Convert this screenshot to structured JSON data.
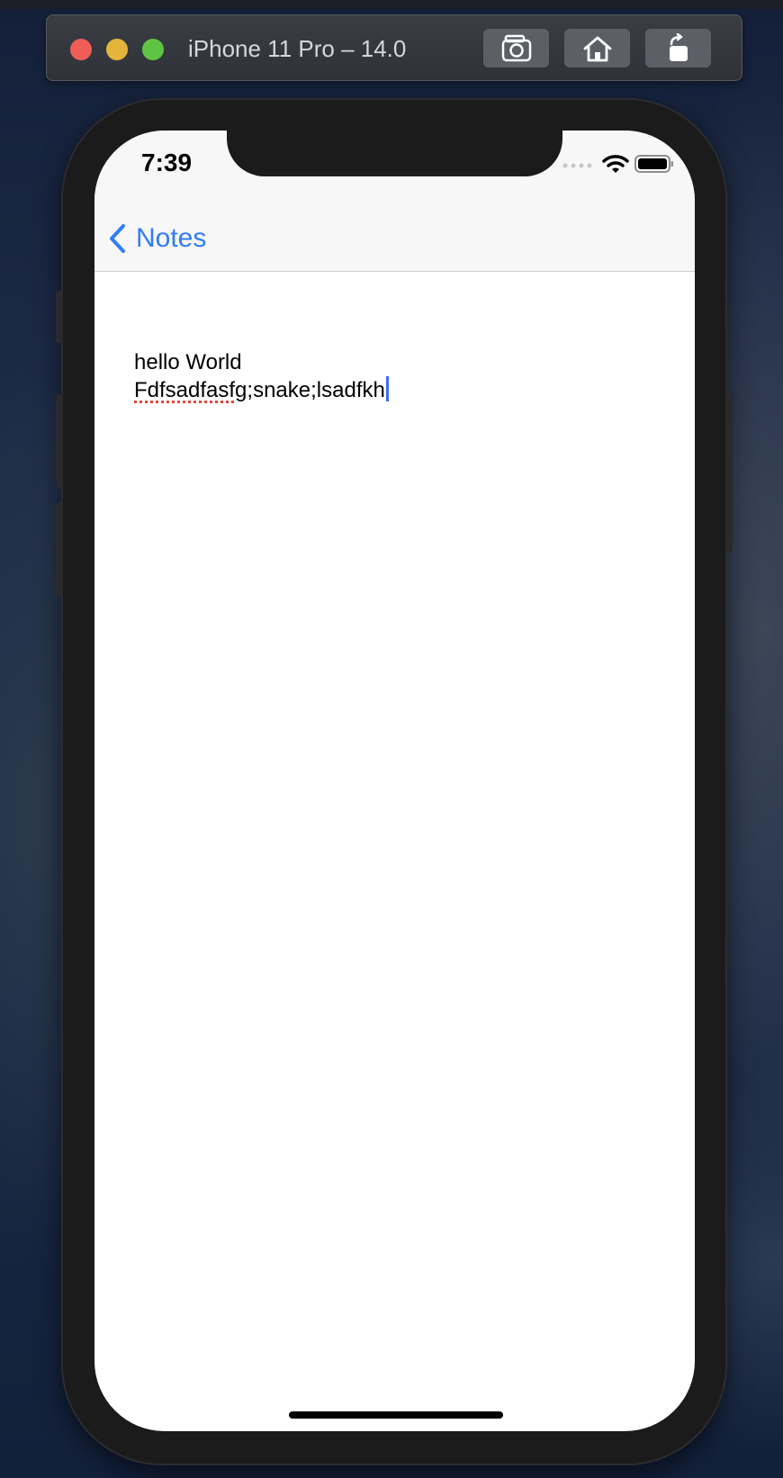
{
  "simulator": {
    "title": "iPhone 11 Pro – 14.0",
    "buttons": [
      {
        "name": "screenshot",
        "icon": "camera-icon"
      },
      {
        "name": "home",
        "icon": "home-icon"
      },
      {
        "name": "rotate",
        "icon": "rotate-icon"
      }
    ]
  },
  "status_bar": {
    "time": "7:39",
    "icons": [
      "cellular-icon",
      "wifi-icon",
      "battery-icon"
    ]
  },
  "nav": {
    "back_label": "Notes",
    "accent_color": "#2f7df6"
  },
  "note": {
    "line1": "hello World",
    "line2_misspelled": "Fdfsadfasfg",
    "line2_rest": ";snake;lsadfkh"
  }
}
